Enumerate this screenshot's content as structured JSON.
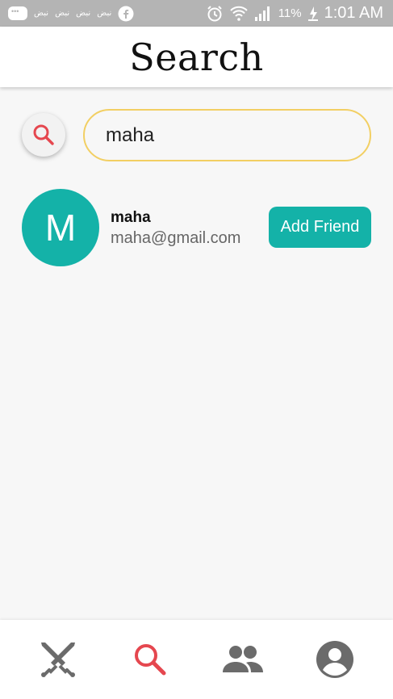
{
  "status_bar": {
    "notifications": [
      "نبض",
      "نبض",
      "نبض",
      "نبض"
    ],
    "battery": "11%",
    "time": "1:01 AM"
  },
  "header": {
    "title": "Search"
  },
  "search": {
    "value": "maha",
    "icon": "search-icon"
  },
  "results": [
    {
      "initial": "M",
      "name": "maha",
      "email": "maha@gmail.com",
      "button_label": "Add Friend"
    }
  ],
  "nav": {
    "items": [
      {
        "icon": "swords-icon",
        "active": false
      },
      {
        "icon": "search-icon",
        "active": true
      },
      {
        "icon": "group-icon",
        "active": false
      },
      {
        "icon": "account-circle-icon",
        "active": false
      }
    ]
  },
  "colors": {
    "accent_teal": "#14b2a8",
    "search_red": "#e5474f",
    "input_border": "#f2cf63",
    "nav_gray": "#6b6b6b"
  }
}
